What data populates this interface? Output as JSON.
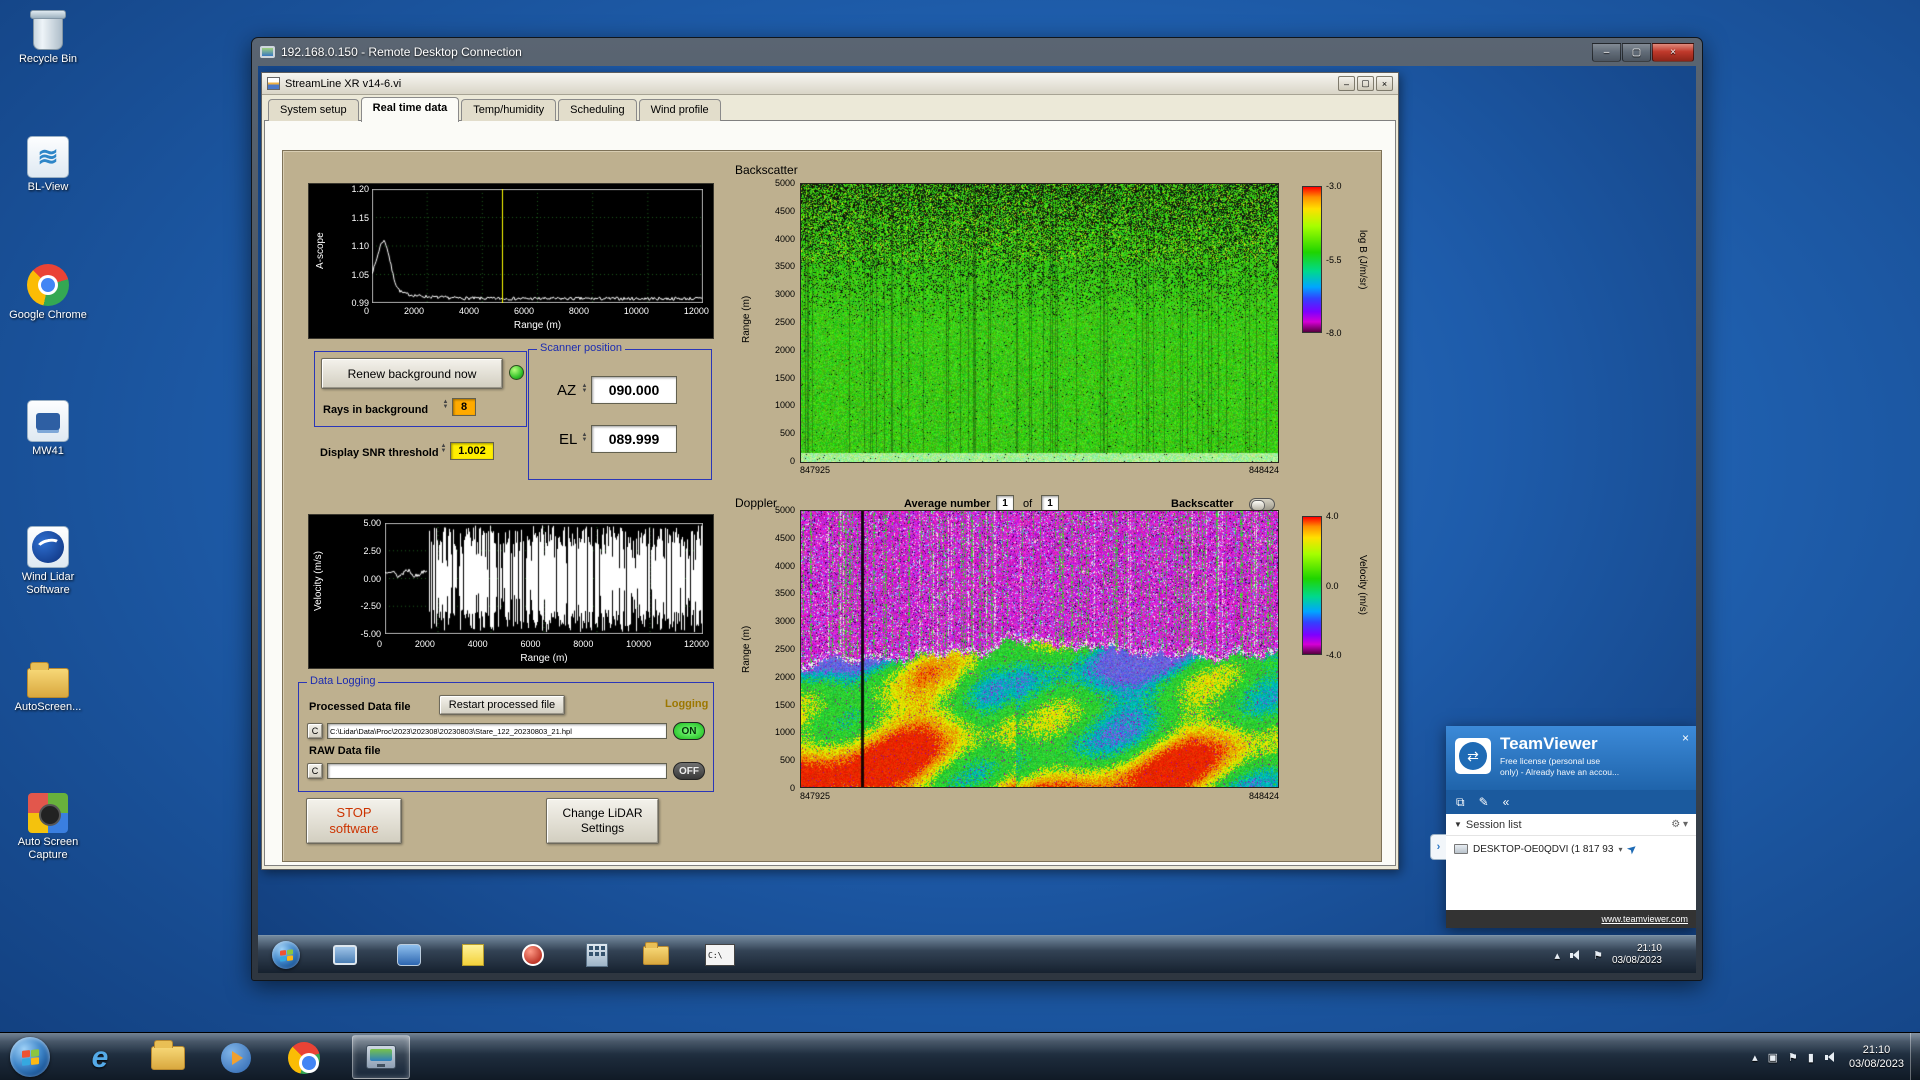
{
  "desktop": {
    "icons": [
      {
        "name": "recycle-bin",
        "label": "Recycle Bin"
      },
      {
        "name": "bl-view",
        "label": "BL-View"
      },
      {
        "name": "google-chrome",
        "label": "Google Chrome"
      },
      {
        "name": "mw41",
        "label": "MW41"
      },
      {
        "name": "wind-lidar-software",
        "label": "Wind Lidar Software"
      },
      {
        "name": "autoscreen",
        "label": "AutoScreen..."
      },
      {
        "name": "auto-screen-capture",
        "label": "Auto Screen Capture"
      }
    ]
  },
  "rdp_window": {
    "title": "192.168.0.150 - Remote Desktop Connection"
  },
  "app_window": {
    "title": "StreamLine XR v14-6.vi",
    "tabs": [
      "System setup",
      "Real time data",
      "Temp/humidity",
      "Scheduling",
      "Wind profile"
    ],
    "active_tab": "Real time data",
    "ascope": {
      "ylabel": "A-scope",
      "yticks": [
        "1.20",
        "1.15",
        "1.10",
        "1.05",
        "0.99"
      ],
      "xlabel": "Range (m)",
      "xticks": [
        "0",
        "2000",
        "4000",
        "6000",
        "8000",
        "10000",
        "12000"
      ]
    },
    "background_controls": {
      "renew_button": "Renew background now",
      "rays_label": "Rays in background",
      "rays_value": "8",
      "snr_label": "Display SNR threshold",
      "snr_value": "1.002"
    },
    "scanner": {
      "title": "Scanner position",
      "az_label": "AZ",
      "az_value": "090.000",
      "el_label": "EL",
      "el_value": "089.999"
    },
    "backscatter": {
      "section_label": "Backscatter",
      "ylabel": "Range (m)",
      "yticks": [
        "5000",
        "4500",
        "4000",
        "3500",
        "3000",
        "2500",
        "2000",
        "1500",
        "1000",
        "500",
        "0"
      ],
      "x_left": "847925",
      "x_right": "848424",
      "colorbar_ticks": [
        "-3.0",
        "-5.5",
        "-8.0"
      ],
      "colorbar_label": "log B (J/m/sr)"
    },
    "doppler": {
      "section_label": "Doppler",
      "avg_label": "Average number",
      "avg_value": "1",
      "of_label": "of",
      "of_count": "1",
      "toggle_label": "Backscatter",
      "ylabel": "Range (m)",
      "yticks": [
        "5000",
        "4500",
        "4000",
        "3500",
        "3000",
        "2500",
        "2000",
        "1500",
        "1000",
        "500",
        "0"
      ],
      "x_left": "847925",
      "x_right": "848424",
      "colorbar_ticks": [
        "4.0",
        "0.0",
        "-4.0"
      ],
      "colorbar_label": "Velocity (m/s)"
    },
    "velocity": {
      "ylabel": "Velocity (m/s)",
      "yticks": [
        "5.00",
        "2.50",
        "0.00",
        "-2.50",
        "-5.00"
      ],
      "xlabel": "Range (m)",
      "xticks": [
        "0",
        "2000",
        "4000",
        "6000",
        "8000",
        "10000",
        "12000"
      ]
    },
    "logging": {
      "title": "Data Logging",
      "processed_label": "Processed Data file",
      "restart_button": "Restart processed file",
      "logging_label": "Logging",
      "drive_label": "C",
      "processed_path": "C:\\Lidar\\Data\\Proc\\2023\\202308\\20230803\\Stare_122_20230803_21.hpl",
      "on_label": "ON",
      "raw_label": "RAW Data file",
      "raw_path": "",
      "off_label": "OFF"
    },
    "footer_buttons": {
      "stop_line1": "STOP",
      "stop_line2": "software",
      "change_line1": "Change LiDAR",
      "change_line2": "Settings"
    }
  },
  "teamviewer": {
    "title": "TeamViewer",
    "subtitle_line1": "Free license (personal use",
    "subtitle_line2": "only) - Already have an accou...",
    "session_list": "Session list",
    "entry": "DESKTOP-OE0QDVI (1 817 93",
    "footer_link": "www.teamviewer.com"
  },
  "remote_taskbar": {
    "cmd_label": "C:\\",
    "clock_time": "21:10",
    "clock_date": "03/08/2023"
  },
  "host_taskbar": {
    "clock_time": "21:10",
    "clock_date": "03/08/2023"
  },
  "colors": {
    "panel_tan": "#beb08f",
    "group_border_blue": "#2a36b8",
    "value_orange": "#ffaa00",
    "value_yellow": "#ffee00",
    "on_green": "#2ecc2e",
    "teamviewer_blue": "#2a76c4",
    "colorbar_stops": [
      "#ff0000 0%",
      "#ff9000 7%",
      "#ffe000 15%",
      "#a6ff00 27%",
      "#1fd400 45%",
      "#00d98c 58%",
      "#00a6ff 69%",
      "#3340ff 77%",
      "#7d00ff 86%",
      "#d400d4 93%",
      "#57003f 100%"
    ]
  },
  "chart_data": [
    {
      "type": "line",
      "title": "A-scope",
      "xlabel": "Range (m)",
      "ylabel": "A-scope",
      "xlim": [
        0,
        12000
      ],
      "ylim": [
        0.99,
        1.2
      ],
      "cursor_x": 4700,
      "series_desc": "Noisy white trace rising from ~1.03 at 0 m to a ~1.10 peak near 400 m, decaying to ~1.00 by 2500 m, then flat noise near 1.00 out to 12000 m; yellow cursor line at ~4700 m"
    },
    {
      "type": "heatmap",
      "title": "Backscatter",
      "ylabel": "Range (m)",
      "ylim": [
        0,
        5000
      ],
      "x_range": [
        847925,
        848424
      ],
      "colorbar_label": "log B (J/m/sr)",
      "colorbar_range": [
        -3.0,
        -8.0
      ],
      "description": "Uniform strong green backscatter over the whole record; black dropout speckle increasing above ~2500 m; brighter band near 0 m"
    },
    {
      "type": "line",
      "title": "Doppler velocity vs range",
      "xlabel": "Range (m)",
      "ylabel": "Velocity (m/s)",
      "xlim": [
        0,
        12000
      ],
      "ylim": [
        -5.0,
        5.0
      ],
      "series_desc": "Coherent velocities near 0 m/s below ~1500 m; uncorrelated noise filling the full ±5 m/s span beyond"
    },
    {
      "type": "heatmap",
      "title": "Doppler",
      "ylabel": "Range (m)",
      "ylim": [
        0,
        5000
      ],
      "x_range": [
        847925,
        848424
      ],
      "colorbar_label": "Velocity (m/s)",
      "colorbar_range": [
        4.0,
        -4.0
      ],
      "description": "Magenta/white uncorrelated noise with vertical green streaks above ~2200 m; coherent boundary-layer signal below with green/yellow/red and blue patches"
    }
  ]
}
